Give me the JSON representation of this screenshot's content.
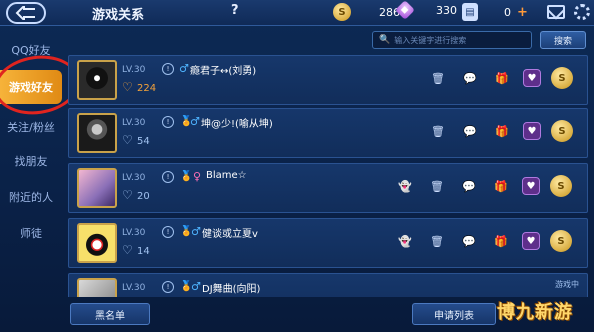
{
  "header": {
    "title": "游戏关系",
    "help_label": "?",
    "gold": "2861",
    "gems": "330",
    "tickets": "0",
    "plus_label": "+"
  },
  "sidebar": {
    "items": [
      {
        "label": "QQ好友"
      },
      {
        "label": "游戏好友"
      },
      {
        "label": "关注/粉丝"
      },
      {
        "label": "找朋友"
      },
      {
        "label": "附近的人"
      },
      {
        "label": "师徒"
      }
    ],
    "active_index": 1
  },
  "search": {
    "placeholder": "输入关键字进行搜索",
    "button_label": "搜索"
  },
  "friends": [
    {
      "level": "LV.30",
      "likes": "224",
      "hot": true,
      "gender": "♂",
      "gender_class": "male",
      "name": "瘾君子↔(刘勇)",
      "status": ""
    },
    {
      "level": "LV.30",
      "likes": "54",
      "hot": false,
      "gender": "♂",
      "gender_class": "male",
      "name": "坤@少!(喻从坤)",
      "status": ""
    },
    {
      "level": "LV.30",
      "likes": "20",
      "hot": false,
      "gender": "♀",
      "gender_class": "female",
      "name": "Blame☆",
      "status": ""
    },
    {
      "level": "LV.30",
      "likes": "14",
      "hot": false,
      "gender": "♂",
      "gender_class": "male",
      "name": "健谈或立夏v",
      "status": ""
    },
    {
      "level": "LV.30",
      "likes": "",
      "hot": false,
      "gender": "♂",
      "gender_class": "male",
      "name": "DJ舞曲(向阳)",
      "status": "游戏中"
    }
  ],
  "bottom": {
    "blacklist_label": "黑名单",
    "requests_label": "申请列表"
  },
  "watermark": "博九新游"
}
